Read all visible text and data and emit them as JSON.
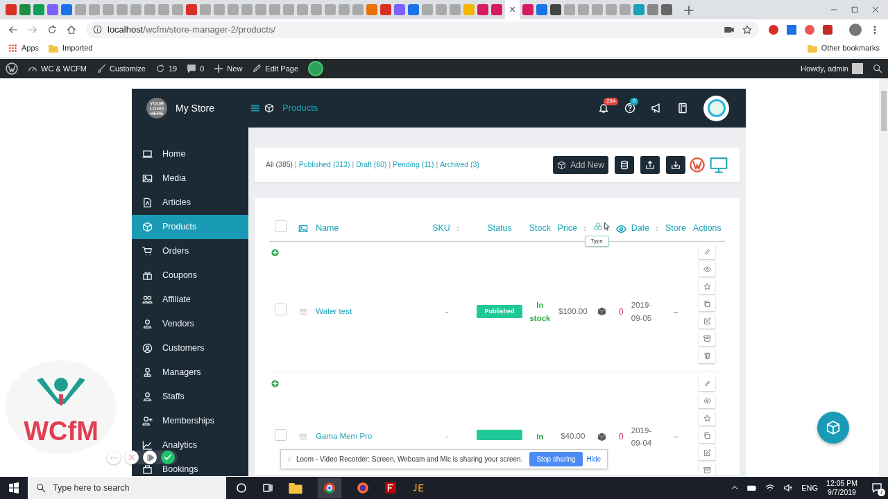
{
  "browser": {
    "tab_close": "×",
    "address": {
      "host": "localhost",
      "path": "/wcfm/store-manager-2/products/"
    },
    "bookmarks": [
      {
        "label": "Apps"
      },
      {
        "label": "Imported"
      }
    ],
    "other_bookmarks": "Other bookmarks"
  },
  "admin_bar": {
    "items": [
      {
        "label": "WC & WCFM"
      },
      {
        "label": "Customize"
      },
      {
        "label": "19"
      },
      {
        "label": "0"
      },
      {
        "label": "New"
      },
      {
        "label": "Edit Page"
      }
    ],
    "greeting": "Howdy, admin"
  },
  "store": {
    "logo_text": "YOUR LOGO HERE",
    "name": "My Store",
    "page_title": "Products",
    "badges": [
      {
        "count": "284",
        "color": "#e2453c"
      },
      {
        "count": "0",
        "color": "#17a2b8"
      }
    ]
  },
  "sidebar": {
    "items": [
      {
        "label": "Home",
        "selected": false
      },
      {
        "label": "Media",
        "selected": false
      },
      {
        "label": "Articles",
        "selected": false
      },
      {
        "label": "Products",
        "selected": true
      },
      {
        "label": "Orders",
        "selected": false
      },
      {
        "label": "Coupons",
        "selected": false
      },
      {
        "label": "Affiliate",
        "selected": false
      },
      {
        "label": "Vendors",
        "selected": false
      },
      {
        "label": "Customers",
        "selected": false
      },
      {
        "label": "Managers",
        "selected": false
      },
      {
        "label": "Staffs",
        "selected": false
      },
      {
        "label": "Memberships",
        "selected": false
      },
      {
        "label": "Analytics",
        "selected": false
      },
      {
        "label": "Bookings",
        "selected": false
      }
    ]
  },
  "filters": [
    {
      "label": "All (385)",
      "selected": true
    },
    {
      "label": "Published (313)",
      "selected": false
    },
    {
      "label": "Draft (60)",
      "selected": false
    },
    {
      "label": "Pending (11)",
      "selected": false
    },
    {
      "label": "Archived (3)",
      "selected": false
    }
  ],
  "filter_separator": "|",
  "add_new": "Add New",
  "table": {
    "columns": [
      {
        "kind": "checkbox"
      },
      {
        "kind": "image"
      },
      {
        "kind": "text",
        "label": "Name",
        "sortable": false
      },
      {
        "kind": "text",
        "label": "SKU",
        "sortable": true
      },
      {
        "kind": "text",
        "label": "Status",
        "sortable": false
      },
      {
        "kind": "text",
        "label": "Stock",
        "sortable": false
      },
      {
        "kind": "text",
        "label": "Price",
        "sortable": true
      },
      {
        "kind": "type"
      },
      {
        "kind": "views"
      },
      {
        "kind": "text",
        "label": "Date",
        "sortable": true
      },
      {
        "kind": "text",
        "label": "Store",
        "sortable": false
      },
      {
        "kind": "text",
        "label": "Actions",
        "sortable": false
      }
    ],
    "tooltip": "Type",
    "select_all_checked": false,
    "rows": [
      {
        "checked": false,
        "name": "Water test",
        "sku": "-",
        "status": "Published",
        "stock": "In stock",
        "price": "$100.00",
        "views": "0",
        "date": "2019-09-05",
        "store": "–"
      },
      {
        "checked": false,
        "name": "Gama Mem Pro",
        "sku": "-",
        "stock": "In",
        "price": "$40.00",
        "views": "0",
        "date": "2019-09-04",
        "store": "–"
      }
    ]
  },
  "overlays": {
    "brand": "WCfM",
    "recorder_more": "···",
    "share_banner": {
      "message": "Loom - Video Recorder: Screen, Webcam and Mic is sharing your screen.",
      "stop": "Stop sharing",
      "hide": "Hide"
    }
  },
  "taskbar": {
    "search_placeholder": "Type here to search",
    "language": "ENG",
    "time": "12:05 PM",
    "date": "9/7/2019",
    "notifications": "7"
  }
}
